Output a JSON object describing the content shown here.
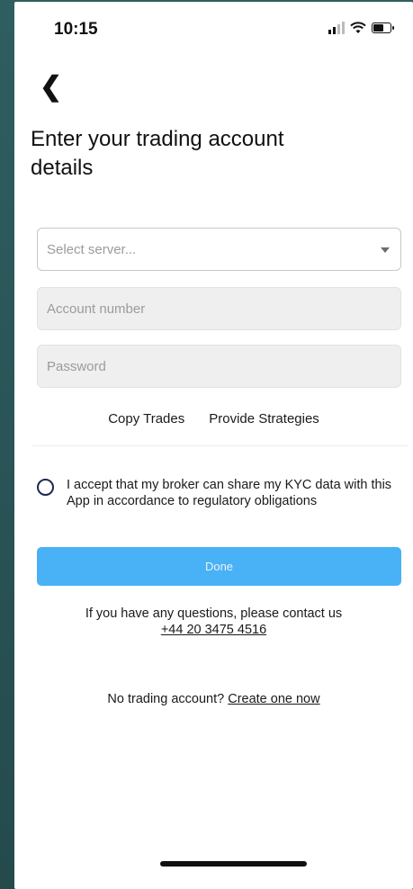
{
  "status_bar": {
    "time": "10:15"
  },
  "page": {
    "title": "Enter your trading account details"
  },
  "form": {
    "server_placeholder": "Select server...",
    "account_placeholder": "Account number",
    "password_placeholder": "Password"
  },
  "options": {
    "copy_trades": "Copy Trades",
    "provide_strategies": "Provide Strategies"
  },
  "consent": {
    "text": "I accept that my broker can share my KYC data with this App in accordance to regulatory obligations"
  },
  "done_button": {
    "label": "Done"
  },
  "contact": {
    "text": "If you have any questions, please contact us",
    "phone": "+44 20 3475 4516"
  },
  "no_account": {
    "text": "No trading account?",
    "link": "Create one now"
  },
  "colors": {
    "accent": "#49b1f5",
    "radio": "#1d2a4d"
  },
  "icons": {
    "back": "chevron-left-icon",
    "dropdown": "caret-down-icon",
    "signal": "signal-icon",
    "wifi": "wifi-icon",
    "battery": "battery-icon"
  }
}
